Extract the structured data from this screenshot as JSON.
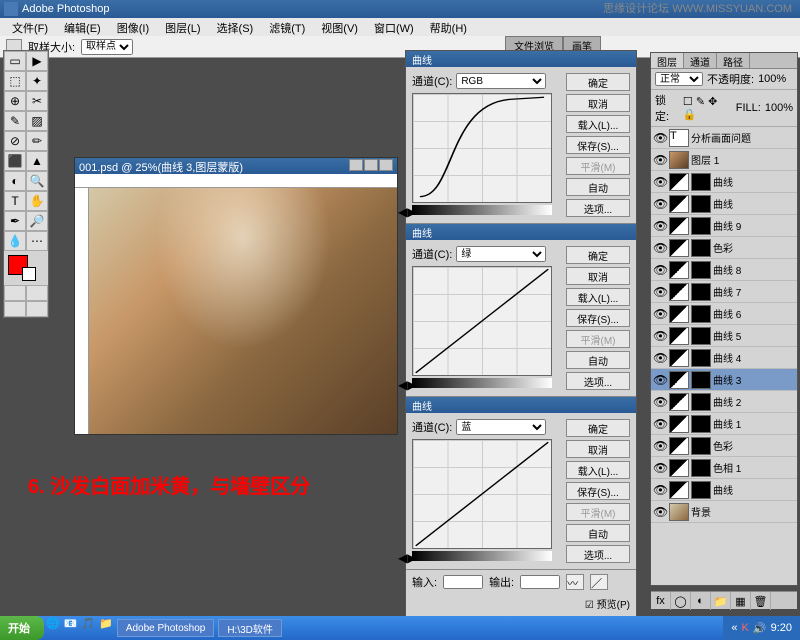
{
  "watermark": "思缘设计论坛  WWW.MISSYUAN.COM",
  "app_title": "Adobe Photoshop",
  "menu": [
    "文件(F)",
    "编辑(E)",
    "图像(I)",
    "图层(L)",
    "选择(S)",
    "滤镜(T)",
    "视图(V)",
    "窗口(W)",
    "帮助(H)"
  ],
  "options": {
    "sample_label": "取样大小:",
    "sample_value": "取样点"
  },
  "side_tabs": [
    "文件浏览",
    "画笔"
  ],
  "doc": {
    "title": "001.psd @ 25%(曲线 3,图层蒙版)"
  },
  "annotation": "6. 沙发白面加米黄，与墙壁区分",
  "curves": {
    "sections": [
      {
        "title": "曲线",
        "channel_label": "通道(C):",
        "channel": "RGB",
        "curve": "s"
      },
      {
        "title": "曲线",
        "channel_label": "通道(C):",
        "channel": "绿",
        "curve": "line"
      },
      {
        "title": "曲线",
        "channel_label": "通道(C):",
        "channel": "蓝",
        "curve": "line"
      }
    ],
    "buttons": [
      "确定",
      "取消",
      "载入(L)...",
      "保存(S)...",
      "平滑(M)",
      "自动",
      "选项..."
    ],
    "input": "输入:",
    "output": "输出:",
    "preview": "☑ 预览(P)"
  },
  "layers": {
    "tabs": [
      "图层",
      "通道",
      "路径"
    ],
    "mode": "正常",
    "opacity_label": "不透明度:",
    "opacity": "100%",
    "lock_label": "锁定:",
    "fill_label": "FILL:",
    "fill": "100%",
    "items": [
      {
        "name": "分析画面问题",
        "type": "text"
      },
      {
        "name": "图层 1",
        "type": "img"
      },
      {
        "name": "曲线",
        "type": "adj",
        "mask": true
      },
      {
        "name": "曲线",
        "type": "adj",
        "mask": true
      },
      {
        "name": "曲线 9",
        "type": "adj",
        "mask": true
      },
      {
        "name": "色彩",
        "type": "adj",
        "mask": true
      },
      {
        "name": "曲线 8",
        "type": "adj",
        "mask": true
      },
      {
        "name": "曲线 7",
        "type": "adj",
        "mask": true
      },
      {
        "name": "曲线 6",
        "type": "adj",
        "mask": true
      },
      {
        "name": "曲线 5",
        "type": "adj",
        "mask": true
      },
      {
        "name": "曲线 4",
        "type": "adj",
        "mask": true
      },
      {
        "name": "曲线 3",
        "type": "adj",
        "mask": true,
        "selected": true
      },
      {
        "name": "曲线 2",
        "type": "adj",
        "mask": true
      },
      {
        "name": "曲线 1",
        "type": "adj",
        "mask": true
      },
      {
        "name": "色彩",
        "type": "adj",
        "mask": true
      },
      {
        "name": "色相 1",
        "type": "adj",
        "mask": true
      },
      {
        "name": "曲线",
        "type": "adj",
        "mask": true
      },
      {
        "name": "背景",
        "type": "bg"
      }
    ]
  },
  "taskbar": {
    "start": "开始",
    "items": [
      "Adobe Photoshop",
      "H:\\3D软件"
    ],
    "time": "9:20"
  }
}
